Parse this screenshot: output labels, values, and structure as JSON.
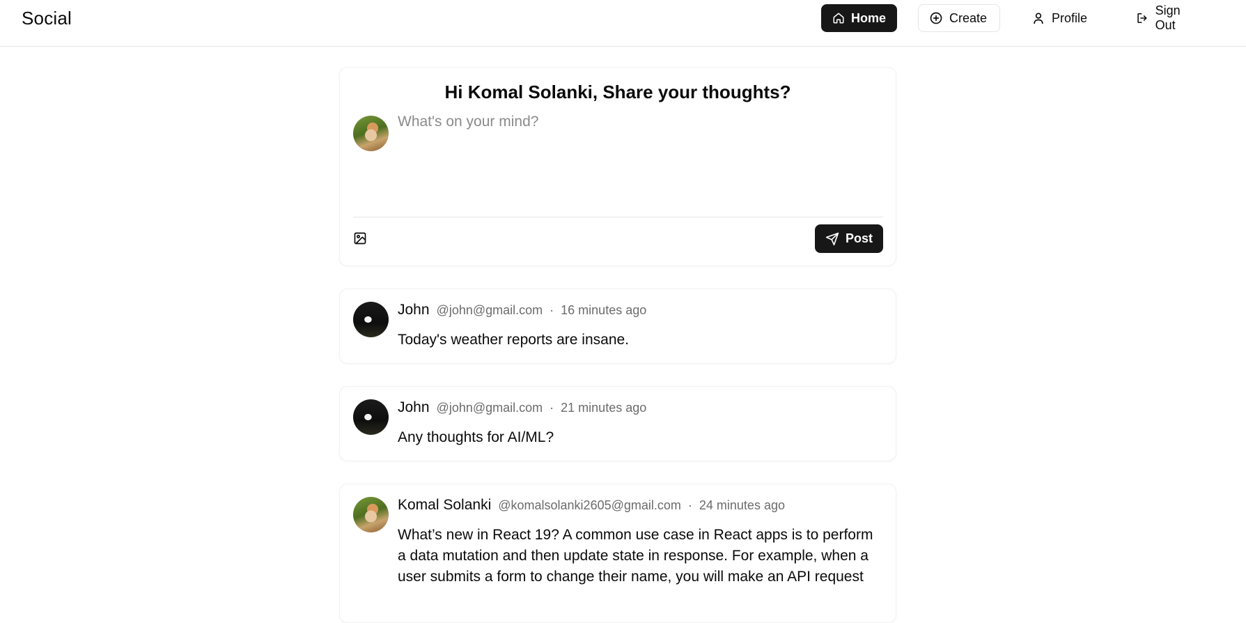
{
  "nav": {
    "brand": "Social",
    "home_label": "Home",
    "create_label": "Create",
    "profile_label": "Profile",
    "signout_label": "Sign Out",
    "active": "Home",
    "icons": [
      "home-icon",
      "plus-circle-icon",
      "user-icon",
      "log-out-icon"
    ]
  },
  "composer": {
    "title": "Hi Komal Solanki, Share your thoughts?",
    "placeholder": "What's on your mind?",
    "value": "",
    "post_label": "Post",
    "icons": [
      "image-icon",
      "send-icon"
    ]
  },
  "posts": [
    {
      "name": "John",
      "handle": "@john@gmail.com",
      "separator": "·",
      "time": "16 minutes ago",
      "body": "Today's weather reports are insane."
    },
    {
      "name": "John",
      "handle": "@john@gmail.com",
      "separator": "·",
      "time": "21 minutes ago",
      "body": "Any thoughts for AI/ML?"
    },
    {
      "name": "Komal Solanki",
      "handle": "@komalsolanki2605@gmail.com",
      "separator": "·",
      "time": "24 minutes ago",
      "body": "What’s new in React 19? A common use case in React apps is to perform a data mutation and then update state in response. For example, when a user submits a form to change their name, you will make an API request"
    }
  ],
  "colors": {
    "primary": "#171717",
    "border": "#e5e5e5",
    "muted_text": "#6b6b6b",
    "placeholder": "#8a8a8a"
  }
}
